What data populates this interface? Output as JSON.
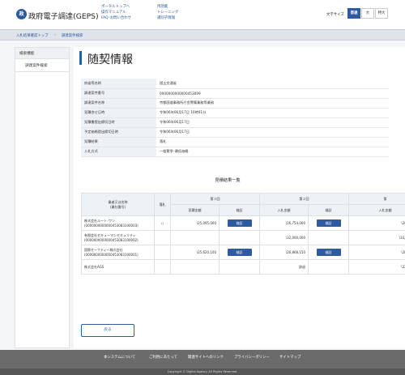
{
  "header": {
    "logo_glyph": "政",
    "site_title": "政府電子調達(GEPS)",
    "links": [
      "ポータルトップへ",
      "操作マニュアル",
      "FAQ･お問い合わせ",
      "用語集",
      "トレーニング",
      "識別子情報"
    ],
    "font_size_label": "文字サイズ",
    "font_sizes": [
      "普通",
      "大",
      "特大"
    ],
    "active_font_size": "普通"
  },
  "breadcrumb": [
    "入札結果確認トップ",
    "調達案件検索"
  ],
  "sidebar": {
    "heading": "検索機能",
    "items": [
      "調達案件検索"
    ]
  },
  "page": {
    "title": "随契情報"
  },
  "info_rows": [
    {
      "label": "府省等名称",
      "value": "国土交通省"
    },
    {
      "label": "調達案件番号",
      "value": "0000000000000453099"
    },
    {
      "label": "調達案件名称",
      "value": "京都国道事務所庁舎警備業務等業務"
    },
    {
      "label": "見積合せ日時",
      "value": "令和06年06月17日 10時01分"
    },
    {
      "label": "見積書提出締切日時",
      "value": "令和06年06月17日"
    },
    {
      "label": "予定価格提出締切日時",
      "value": "令和06年06月17日"
    },
    {
      "label": "見積結果",
      "value": "落札"
    },
    {
      "label": "入札方式",
      "value": "一般競争･最低価格"
    }
  ],
  "results": {
    "caption": "見積結果一覧",
    "col_name": "業者又は名称\n(業社番号)",
    "col_award": "落札",
    "rounds": [
      "第３回",
      "第２回",
      "第"
    ],
    "sub_amount": "見積金額",
    "sub_amount2": "入札金額",
    "sub_verify": "検証",
    "verify_label": "検証",
    "rows": [
      {
        "name": "株式会社ルート･ワン",
        "code": "(0000000000000453083100003)",
        "award": "○",
        "r3_amount": "\\25,095,000",
        "r3_verify": true,
        "r2_amount": "\\26,754,000",
        "r2_verify": true,
        "r1_amount": "\\28,479,99"
      },
      {
        "name": "有限会社セキューマンセキュリティ",
        "code": "(0000000000000453083100002)",
        "award": "",
        "r3_amount": "",
        "r3_verify": false,
        "r2_amount": "\\32,000,000",
        "r2_verify": false,
        "r1_amount": "\\33,000,000"
      },
      {
        "name": "国際セーフティー株式会社",
        "code": "(0000000000000453083100001)",
        "award": "",
        "r3_amount": "\\25,620,100",
        "r3_verify": true,
        "r2_amount": "\\26,868,150",
        "r2_verify": true,
        "r1_amount": "\\28,879,75"
      },
      {
        "name": "株式会社AGS",
        "code": "",
        "award": "",
        "r3_amount": "",
        "r3_verify": false,
        "r2_amount": "辞退",
        "r2_verify": false,
        "r1_amount": "\\32,145,40"
      }
    ]
  },
  "back_label": "戻る",
  "footer": {
    "links": [
      "本システムについて",
      "ご利用にあたって",
      "関連サイトへのリンク",
      "プライバシーポリシー",
      "サイトマップ"
    ],
    "copyright": "Copyright © Digital Agency All Rights Reserved."
  }
}
